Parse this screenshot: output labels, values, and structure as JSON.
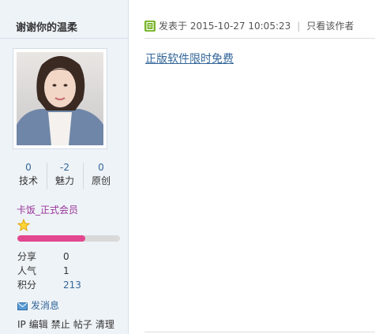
{
  "user": {
    "name": "谢谢你的温柔"
  },
  "stats": [
    {
      "value": "0",
      "label": "技术"
    },
    {
      "value": "-2",
      "label": "魅力"
    },
    {
      "value": "0",
      "label": "原创"
    }
  ],
  "rank": {
    "label": "卡饭_正式会员",
    "progress_percent": 66
  },
  "details": [
    {
      "key": "分享",
      "value": "0"
    },
    {
      "key": "人气",
      "value": "1"
    },
    {
      "key": "积分",
      "value": "213"
    }
  ],
  "send_message_label": "发消息",
  "admin_links": [
    "IP",
    "编辑",
    "禁止",
    "帖子",
    "清理"
  ],
  "post": {
    "posted_at": "发表于 2015-10-27 10:05:23",
    "only_author": "只看该作者",
    "link_text": "正版软件限时免费"
  },
  "colors": {
    "sidebar_bg": "#eef3f7",
    "link": "#336699",
    "rank": "#993399",
    "progress": "#e2478f"
  }
}
